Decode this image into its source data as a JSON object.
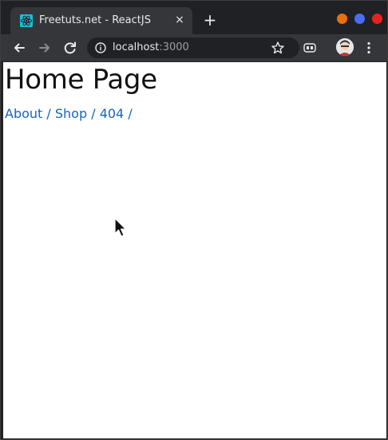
{
  "tab": {
    "title": "Freetuts.net - ReactJS",
    "close_label": "×",
    "favicon": "react-icon"
  },
  "new_tab_label": "+",
  "window_controls": {
    "minimize_color": "#e8710a",
    "maximize_color": "#4a6cf7",
    "close_color": "#e8221b"
  },
  "toolbar": {
    "back_icon": "arrow-left-icon",
    "forward_icon": "arrow-right-icon",
    "reload_icon": "reload-icon",
    "url_host": "localhost",
    "url_port": ":3000",
    "bookmark_icon": "star-icon",
    "extension_icon": "extension-icon",
    "menu_icon": "kebab-menu-icon"
  },
  "page": {
    "title": "Home Page",
    "nav": [
      {
        "label": "About"
      },
      {
        "label": "Shop"
      },
      {
        "label": "404"
      }
    ],
    "separator": " / ",
    "link_color": "#1565c0"
  }
}
